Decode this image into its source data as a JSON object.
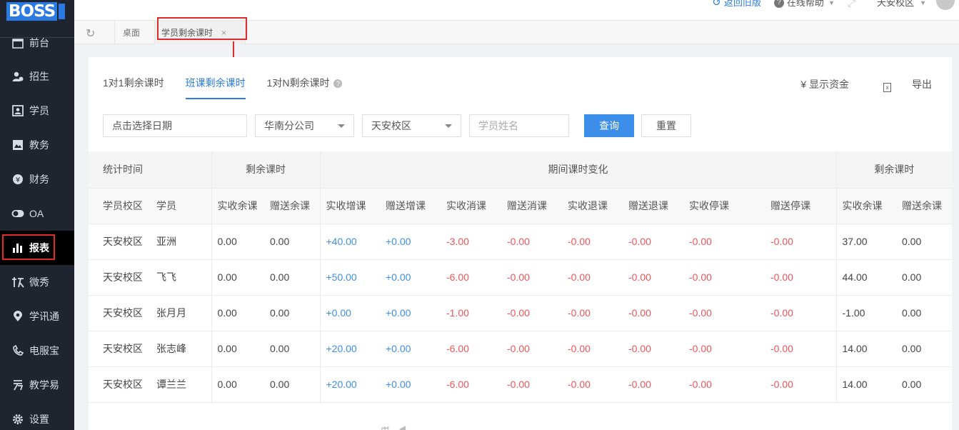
{
  "logo": "BOSS",
  "sidebar": {
    "items": [
      {
        "label": "前台",
        "icon": "calendar-icon"
      },
      {
        "label": "招生",
        "icon": "user-plus-icon"
      },
      {
        "label": "学员",
        "icon": "student-card-icon"
      },
      {
        "label": "教务",
        "icon": "book-icon"
      },
      {
        "label": "财务",
        "icon": "yen-coin-icon"
      },
      {
        "label": "OA",
        "icon": "toggle-icon"
      },
      {
        "label": "报表",
        "icon": "bar-chart-icon"
      },
      {
        "label": "微秀",
        "icon": "weixiu-icon"
      },
      {
        "label": "学讯通",
        "icon": "location-pin-icon"
      },
      {
        "label": "电服宝",
        "icon": "phone-service-icon"
      },
      {
        "label": "教学易",
        "icon": "teach-easy-icon"
      },
      {
        "label": "设置",
        "icon": "gear-icon"
      }
    ]
  },
  "topbar": {
    "back_old": "返回旧版",
    "help": "在线帮助",
    "campus": "天安校区"
  },
  "tabs": {
    "home": "桌面",
    "current": "学员剩余课时",
    "close": "×"
  },
  "subtabs": [
    "1对1剩余课时",
    "班课剩余课时",
    "1对N剩余课时"
  ],
  "actions": {
    "show_funds": "¥ 显示资金",
    "export": "导出"
  },
  "filters": {
    "date_placeholder": "点击选择日期",
    "company": "华南分公司",
    "campus": "天安校区",
    "name_placeholder": "学员姓名",
    "query": "查询",
    "reset": "重置"
  },
  "table": {
    "group_headers": [
      "统计时间",
      "剩余课时",
      "期间课时变化",
      "剩余课时"
    ],
    "columns": [
      "学员校区",
      "学员",
      "实收余课",
      "赠送余课",
      "实收增课",
      "赠送增课",
      "实收消课",
      "赠送消课",
      "实收退课",
      "赠送退课",
      "实收停课",
      "赠送停课",
      "实收余课",
      "赠送余课"
    ],
    "rows": [
      [
        "天安校区",
        "亚洲",
        "0.00",
        "0.00",
        "+40.00",
        "+0.00",
        "-3.00",
        "-0.00",
        "-0.00",
        "-0.00",
        "-0.00",
        "-0.00",
        "37.00",
        "0.00"
      ],
      [
        "天安校区",
        "飞飞",
        "0.00",
        "0.00",
        "+50.00",
        "+0.00",
        "-6.00",
        "-0.00",
        "-0.00",
        "-0.00",
        "-0.00",
        "-0.00",
        "44.00",
        "0.00"
      ],
      [
        "天安校区",
        "张月月",
        "0.00",
        "0.00",
        "+0.00",
        "+0.00",
        "-1.00",
        "-0.00",
        "-0.00",
        "-0.00",
        "-0.00",
        "-0.00",
        "-1.00",
        "0.00"
      ],
      [
        "天安校区",
        "张志峰",
        "0.00",
        "0.00",
        "+20.00",
        "+0.00",
        "-6.00",
        "-0.00",
        "-0.00",
        "-0.00",
        "-0.00",
        "-0.00",
        "14.00",
        "0.00"
      ],
      [
        "天安校区",
        "谭兰兰",
        "0.00",
        "0.00",
        "+20.00",
        "+0.00",
        "-6.00",
        "-0.00",
        "-0.00",
        "-0.00",
        "-0.00",
        "-0.00",
        "14.00",
        "0.00"
      ]
    ]
  },
  "colors": {
    "accent": "#2e7de1",
    "negative": "#f0555a",
    "highlight": "#e02b2b",
    "sidebar": "#20242e"
  }
}
